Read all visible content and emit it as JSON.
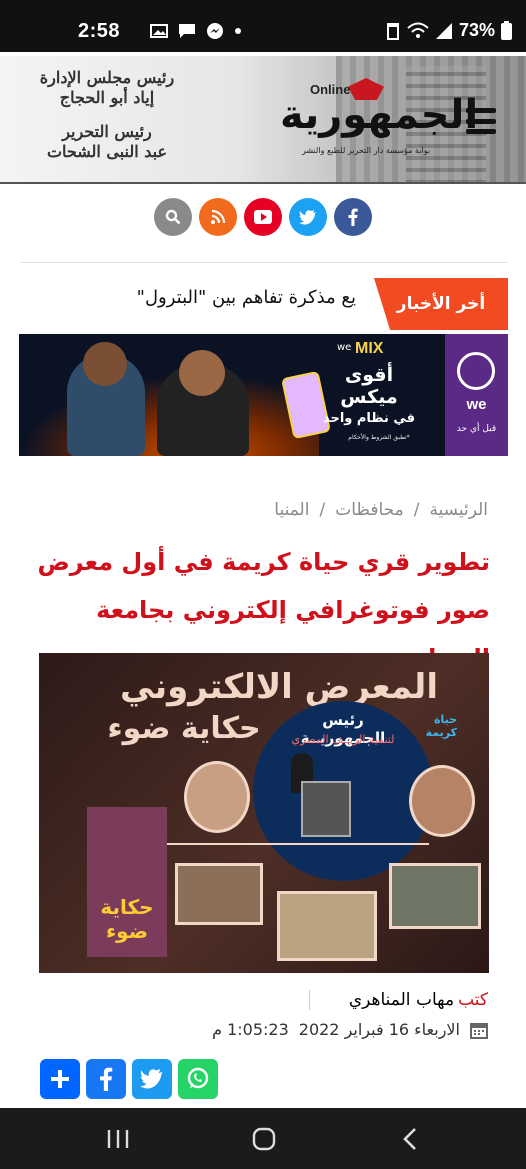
{
  "status_bar": {
    "time": "2:58",
    "battery": "73%"
  },
  "header": {
    "logo_name": "الجمهورية",
    "logo_online": "Online",
    "logo_tagline": "بوابة مؤسسة دار التحرير للطبع والنشر",
    "credit_board_title": "رئيس مجلس الإدارة",
    "credit_board_name": "إياد أبو الحجاج",
    "credit_editor_title": "رئيس التحرير",
    "credit_editor_name": "عبد النبى الشحات"
  },
  "social_icons": [
    "search-icon",
    "rss-icon",
    "youtube-icon",
    "twitter-icon",
    "facebook-icon"
  ],
  "ticker": {
    "label": "أخر الأخبار",
    "text": "يع مذكرة تفاهم بين \"البترول\""
  },
  "banner": {
    "brand": "we",
    "product": "MIX",
    "slogan_line1": "أقوى",
    "slogan_line2": "ميكس",
    "slogan_line3": "في نظام واحد",
    "brand_tagline": "قبل أي حد",
    "small_print": "*تطبق الشروط والأحكام"
  },
  "breadcrumb": [
    "الرئيسية",
    "محافظات",
    "المنيا"
  ],
  "article": {
    "title": "تطوير قري حياة كريمة في أول معرض صور فوتوغرافي إلكتروني بجامعة المنيا",
    "image_heading1": "المعرض الالكتروني",
    "image_heading2": "حكاية ضوء",
    "image_circle_title": "رئيس الجمهوريــة",
    "image_circle_subtitle": "لتنمية الريــف المصري",
    "image_side_text": "حياة كريمة",
    "image_poster_text": "حكاية ضوء",
    "author_prefix": "كتب",
    "author_name": "مهاب المناهري",
    "date": "الاربعاء 16 فبراير 2022",
    "time": "1:05:23 م"
  },
  "share_buttons": [
    "add-share-icon",
    "facebook-share-icon",
    "twitter-share-icon",
    "whatsapp-share-icon"
  ],
  "colors": {
    "accent_red": "#d0111b",
    "ticker_orange": "#f24b22",
    "facebook": "#3b5998",
    "twitter": "#1da1f2",
    "youtube": "#e60023",
    "rss": "#f26a1b",
    "search": "#8a8a8a",
    "whatsapp": "#25d366"
  }
}
